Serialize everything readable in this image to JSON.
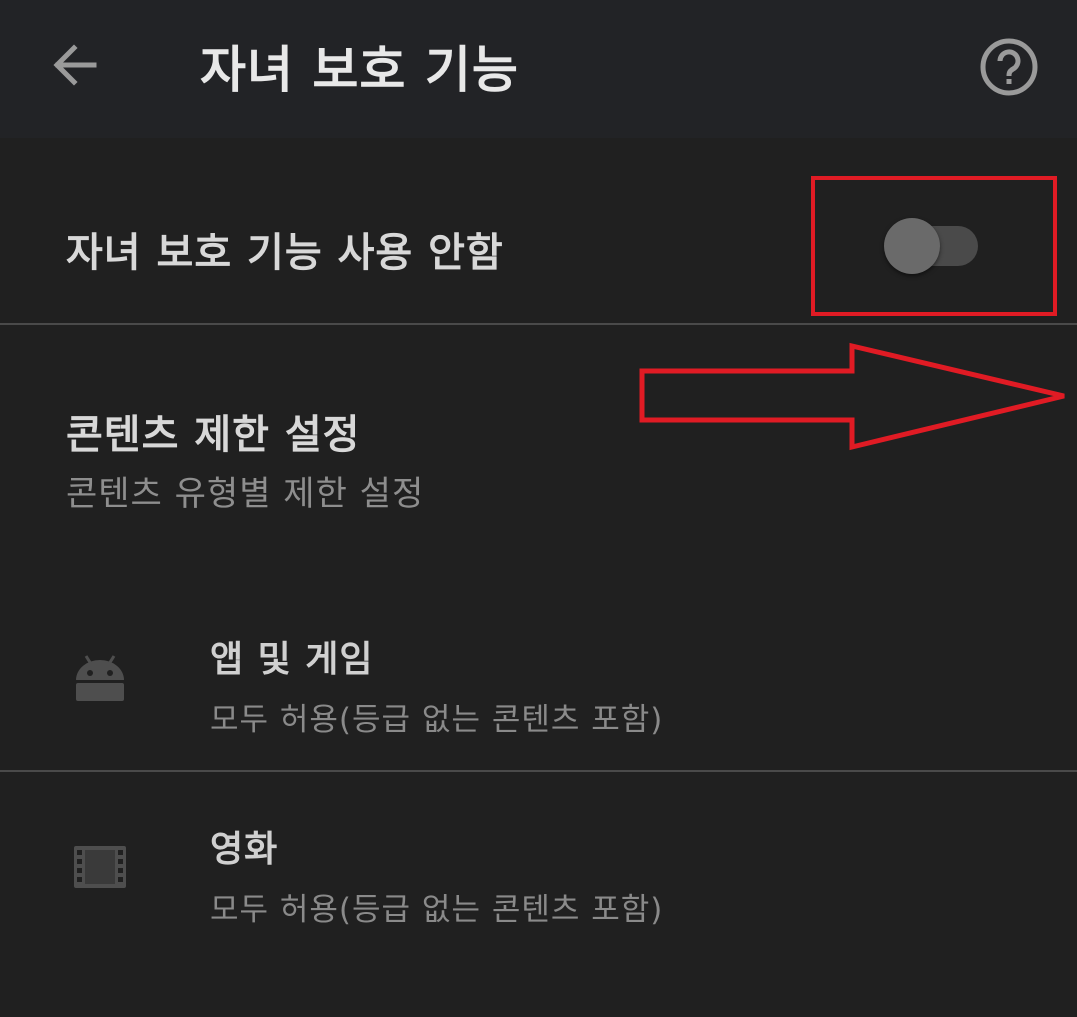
{
  "header": {
    "title": "자녀 보호 기능",
    "back_icon": "arrow-left-icon",
    "help_icon": "help-circle-icon"
  },
  "toggle_row": {
    "label": "자녀 보호 기능 사용 안함",
    "state": "off"
  },
  "content_section": {
    "title": "콘텐츠 제한 설정",
    "subtitle": "콘텐츠 유형별 제한 설정"
  },
  "items": [
    {
      "title": "앱 및 게임",
      "subtitle": "모두 허용(등급 없는 콘텐츠 포함)",
      "icon": "android-icon"
    },
    {
      "title": "영화",
      "subtitle": "모두 허용(등급 없는 콘텐츠 포함)",
      "icon": "film-icon"
    }
  ],
  "colors": {
    "background": "#202020",
    "appbar": "#222326",
    "annotation": "#e01b24"
  }
}
